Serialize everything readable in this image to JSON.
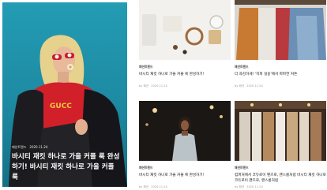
{
  "feature": {
    "category": "패션트렌드",
    "date": "2020.11.24",
    "title": "바시티 재킷 하나로 가을 커플 룩 완성하기! 바시티 재킷 하나로 가을 커플 룩"
  },
  "cards": [
    {
      "category": "패션트렌드",
      "title": "바시티 재킷 하나로 가을 커플 룩 완성하기!",
      "author": "by 패션",
      "date": "2020.11.24"
    },
    {
      "category": "패션트렌드",
      "title": "더 과감하게! '히피 실용'에서 파파한 커튼",
      "author": "by 패션",
      "date": "2020.11.24"
    },
    {
      "category": "패션트렌드",
      "title": "바시티 재킷 하나로 가을 커플 룩 완성하기!",
      "author": "by 패션",
      "date": "2020.11.24"
    },
    {
      "category": "패션트렌드",
      "title": "컴퍼처에서 코듀로이 팬츠로, 맨스룸처럼 바시티 재킷 하나로 코듀로이 팬츠로, 맨스룸처럼",
      "author": "by 패션",
      "date": "2020.11.24"
    }
  ]
}
